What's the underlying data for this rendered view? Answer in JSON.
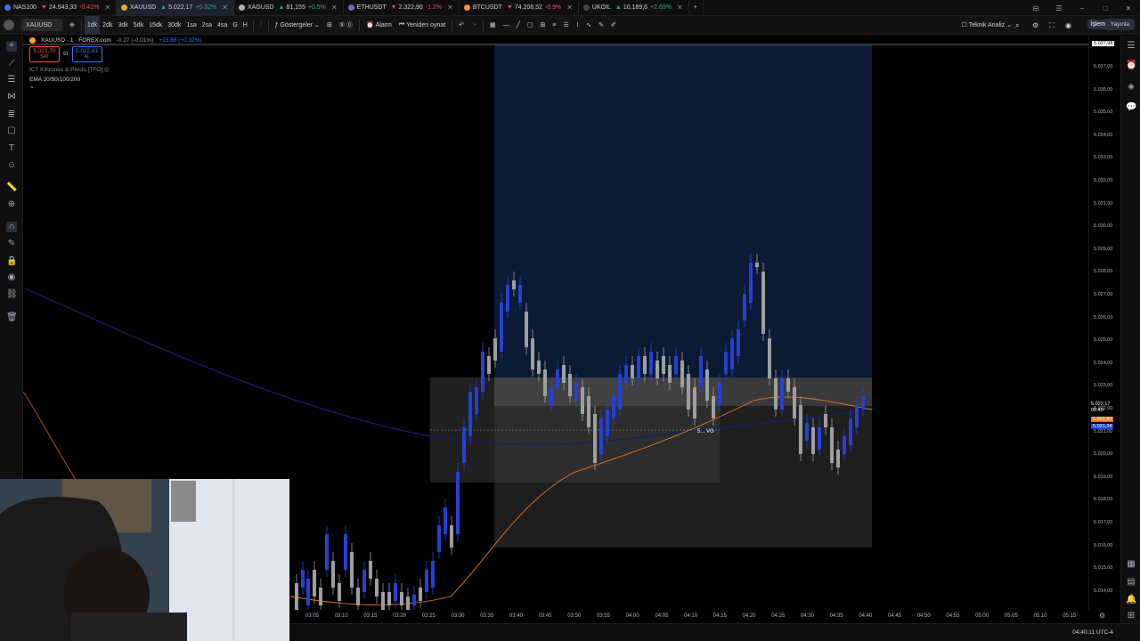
{
  "tabs": [
    {
      "symbol": "NAS100",
      "price": "24.543,33",
      "change": "-0.41%",
      "dir": "dn",
      "color": "#3179f5"
    },
    {
      "symbol": "XAUUSD",
      "price": "5.022,17",
      "change": "+0.32%",
      "dir": "up",
      "color": "#f5a623",
      "active": true
    },
    {
      "symbol": "XAGUSD",
      "price": "81,155",
      "change": "+0.5%",
      "dir": "up",
      "color": "#b0b0b0"
    },
    {
      "symbol": "ETHUSDT",
      "price": "2.322,90",
      "change": "-1.2%",
      "dir": "dn",
      "color": "#6270c4"
    },
    {
      "symbol": "BTCUSDT",
      "price": "74.208,52",
      "change": "-0.9%",
      "dir": "dn",
      "color": "#f7931a"
    },
    {
      "symbol": "UKOIL",
      "price": "10.189,6",
      "change": "+2.69%",
      "dir": "up",
      "color": "#444"
    }
  ],
  "toolbar": {
    "symbol": "XAUUSD",
    "intervals": [
      "1dk",
      "2dk",
      "3dk",
      "5dk",
      "15dk",
      "30dk",
      "1sa",
      "2sa",
      "4sa",
      "G",
      "H"
    ],
    "indicators": "Göstergeler",
    "alarm": "Alarm",
    "replay": "Yeniden oynat",
    "tech": "Teknik Analiz",
    "trade": "İşlem",
    "publish": "Yayınla"
  },
  "legend": {
    "title": "XAUUSD · 1 · FOREX.com",
    "change": "-0.27 (-0.01%)",
    "vol": "+15.86 (+0.32%)",
    "sell_price": "5.021,70",
    "sell_label": "SAT",
    "spread": "91",
    "buy_price": "5.022,61",
    "buy_label": "AL",
    "ind1": "ICT Killzones & Pivots [TFO]",
    "ind2": "EMA 20/50/100/200"
  },
  "price_axis": {
    "top_label": "5.037,98",
    "ticks": [
      "5.037,00",
      "5.036,00",
      "5.035,00",
      "5.034,00",
      "5.033,00",
      "5.032,00",
      "5.031,00",
      "5.030,00",
      "5.029,00",
      "5.028,00",
      "5.027,00",
      "5.026,00",
      "5.025,00",
      "5.024,00",
      "5.023,00",
      "5.022,00",
      "5.021,00",
      "5.020,00",
      "5.019,00",
      "5.018,00",
      "5.017,00",
      "5.016,00",
      "5.015,00",
      "5.014,00"
    ],
    "current_price": "5.022,17",
    "countdown": "00:49",
    "tag2": "5.021,93",
    "tag3": "5.021,34"
  },
  "time_axis": {
    "labels": [
      "03:05",
      "03:10",
      "03:15",
      "03:20",
      "03:25",
      "03:30",
      "03:35",
      "03:40",
      "03:45",
      "03:50",
      "03:55",
      "04:00",
      "04:05",
      "04:10",
      "04:15",
      "04:20",
      "04:25",
      "04:30",
      "04:35",
      "04:40",
      "04:45",
      "04:50",
      "04:55",
      "05:00",
      "05:05",
      "05:10",
      "05:15"
    ],
    "clock": "04:40:11 UTC-4"
  },
  "chart_annotation": "5... VG",
  "colors": {
    "bull": "#2441d6",
    "bear": "#9e9e9e",
    "ema": "#e07b2a",
    "zone": "#0b1a33"
  }
}
